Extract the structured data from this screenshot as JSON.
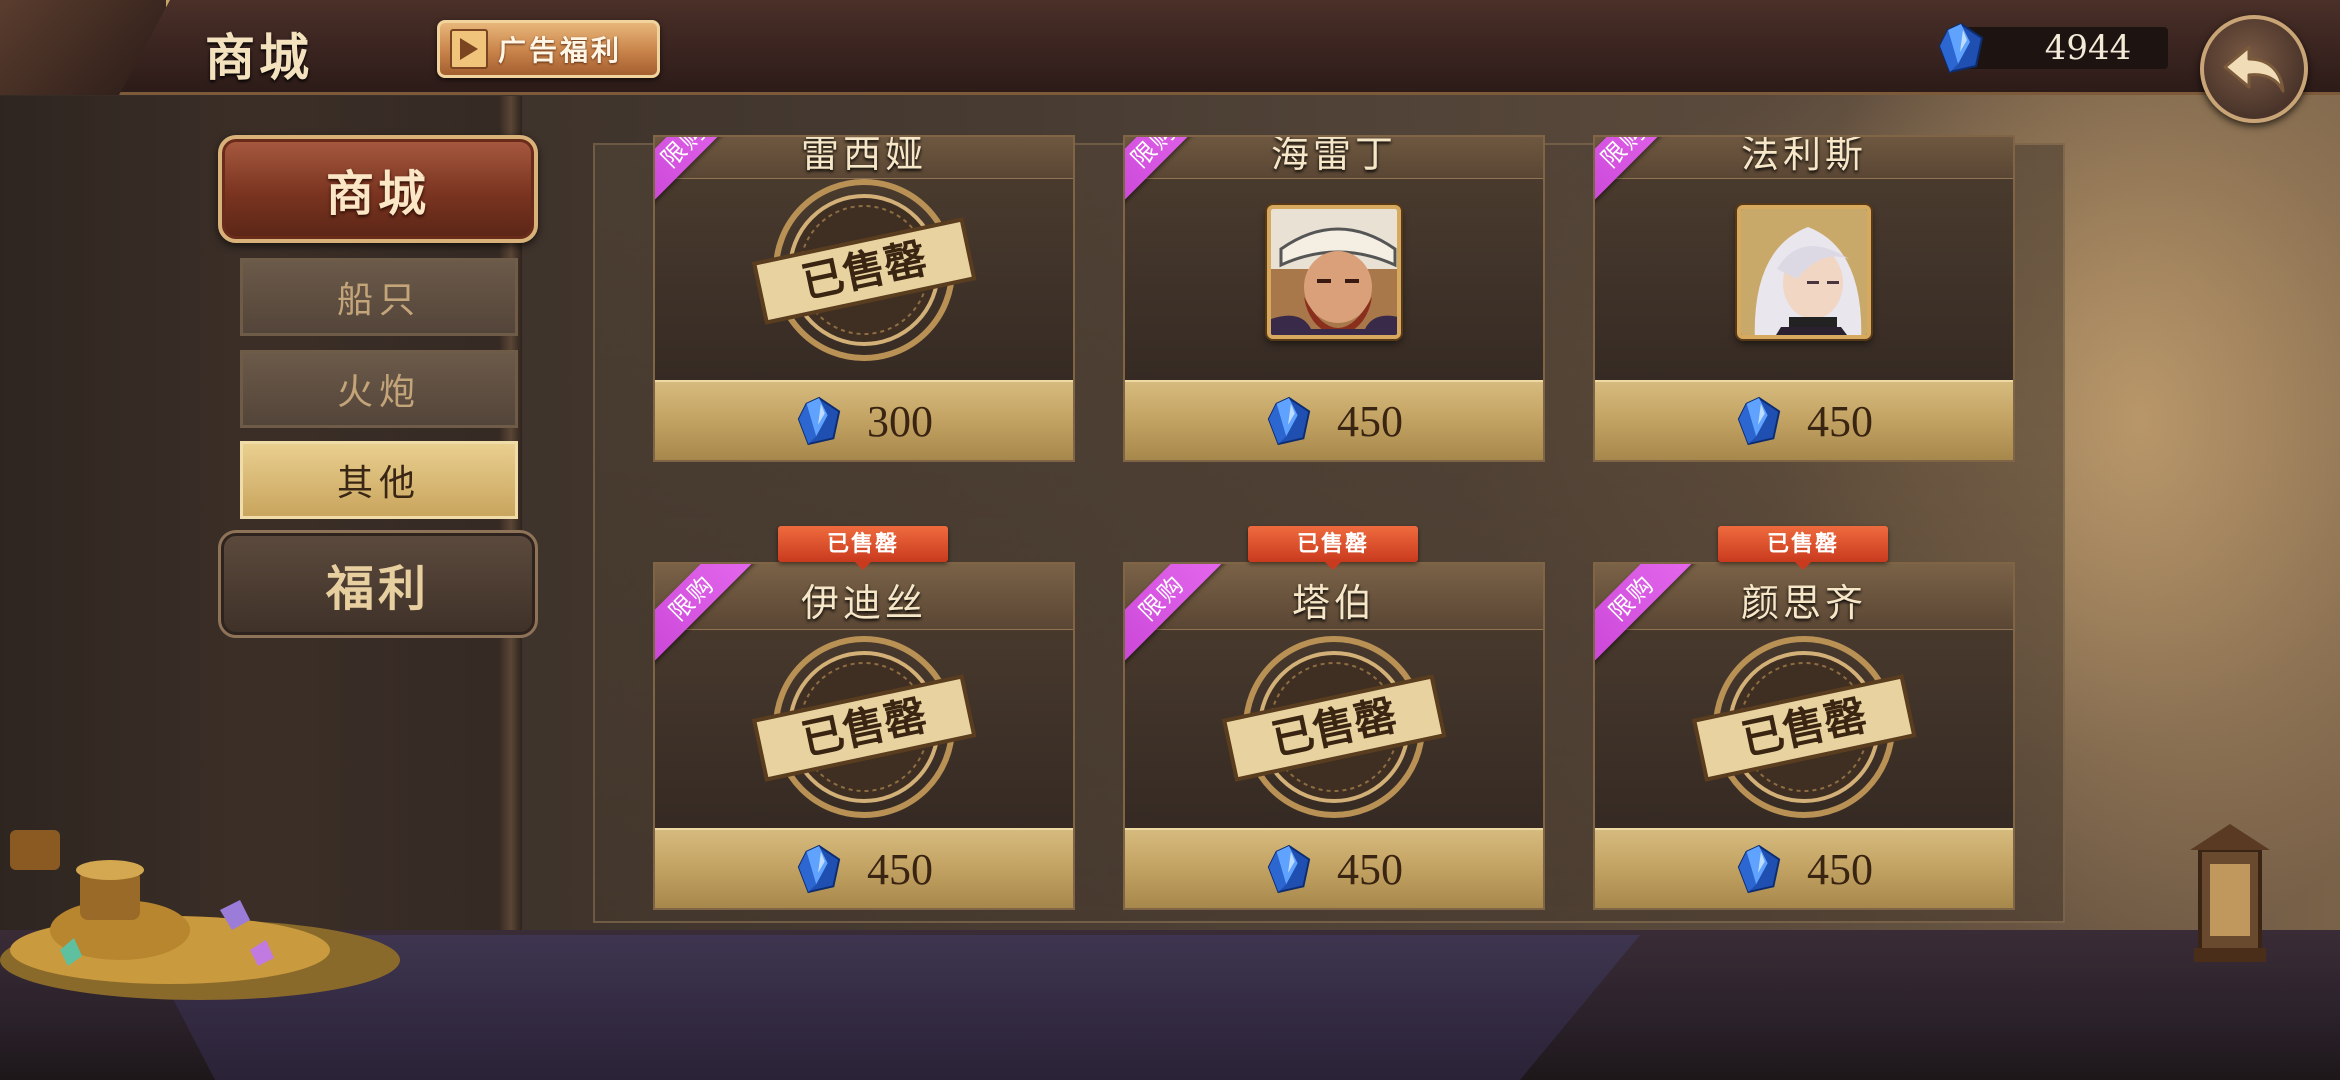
{
  "header": {
    "title": "商城",
    "ad_button_label": "广告福利",
    "gem_count": "4944"
  },
  "sidebar": {
    "main_items": [
      {
        "label": "商城",
        "active": true
      },
      {
        "label": "福利",
        "active": false
      }
    ],
    "sub_items": [
      {
        "label": "船只",
        "active": false
      },
      {
        "label": "火炮",
        "active": false
      },
      {
        "label": "其他",
        "active": true
      }
    ]
  },
  "shop": {
    "limited_label": "限购",
    "soldout_label": "已售罄",
    "stamp_text": "已售罄",
    "items": [
      {
        "name": "雷西娅",
        "price": "300",
        "sold_out": true
      },
      {
        "name": "海雷丁",
        "price": "450",
        "sold_out": false
      },
      {
        "name": "法利斯",
        "price": "450",
        "sold_out": false
      },
      {
        "name": "伊迪丝",
        "price": "450",
        "sold_out": true
      },
      {
        "name": "塔伯",
        "price": "450",
        "sold_out": true
      },
      {
        "name": "颜思齐",
        "price": "450",
        "sold_out": true
      }
    ]
  },
  "colors": {
    "limited_ribbon": "#d955e0",
    "soldout_tag": "#e0502c",
    "price_bar": "#c9aa68",
    "active_tab": "#8a3b24",
    "gem": "#2f6fd8"
  }
}
